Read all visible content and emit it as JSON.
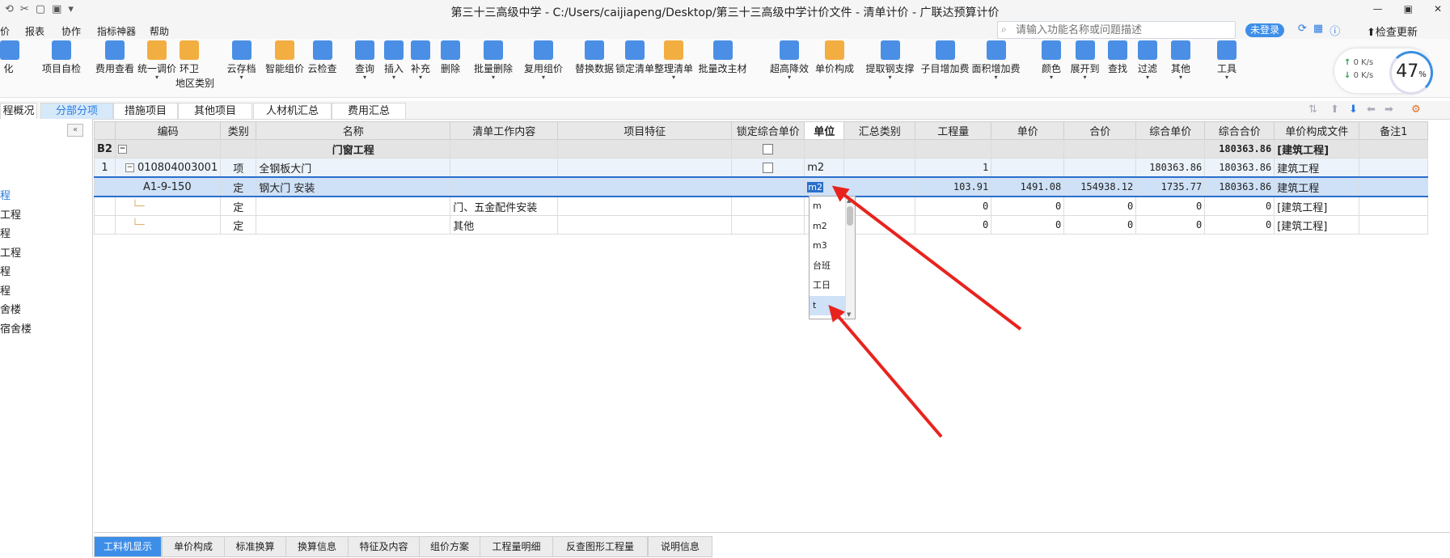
{
  "window": {
    "title": "第三十三高级中学 - C:/Users/caijiapeng/Desktop/第三十三高级中学计价文件 - 清单计价 - 广联达预算计价",
    "quick_access": [
      "⟲",
      "✂",
      "▢",
      "▣",
      "▾"
    ],
    "controls": [
      "—",
      "▣",
      "✕"
    ]
  },
  "menu": {
    "items": [
      "价",
      "报表",
      "协作",
      "指标神器",
      "帮助"
    ]
  },
  "search": {
    "placeholder": "请输入功能名称或问题描述"
  },
  "header_right": {
    "login_label": "未登录",
    "update_label": "检查更新",
    "tool_icons": [
      "⟳",
      "▦",
      "ⓘ"
    ]
  },
  "ribbon": {
    "buttons": [
      {
        "label": "化",
        "color": "#2a7be0",
        "icon": "partial-icon"
      },
      {
        "label": "项目自检",
        "color": "#2a7be0",
        "icon": "check-icon"
      },
      {
        "label": "费用查看",
        "color": "#2a7be0",
        "icon": "cost-view-icon"
      },
      {
        "label": "统一调价",
        "color": "#f0a020",
        "icon": "price-adjust-icon",
        "dropdown": true
      },
      {
        "label": "环卫",
        "sub": "地区类别",
        "color": "#f0a020",
        "icon": "region-icon"
      },
      {
        "label": "云存档",
        "color": "#2a7be0",
        "icon": "cloud-save-icon",
        "dropdown": true
      },
      {
        "label": "智能组价",
        "color": "#f0a020",
        "icon": "smart-price-icon"
      },
      {
        "label": "云检查",
        "color": "#2a7be0",
        "icon": "cloud-check-icon"
      },
      {
        "label": "查询",
        "color": "#2a7be0",
        "icon": "query-icon",
        "dropdown": true
      },
      {
        "label": "插入",
        "color": "#2a7be0",
        "icon": "insert-icon",
        "dropdown": true
      },
      {
        "label": "补充",
        "color": "#2a7be0",
        "icon": "supplement-icon",
        "dropdown": true
      },
      {
        "label": "删除",
        "color": "#2a7be0",
        "icon": "delete-icon"
      },
      {
        "label": "批量删除",
        "color": "#2a7be0",
        "icon": "batch-delete-icon",
        "dropdown": true
      },
      {
        "label": "复用组价",
        "color": "#2a7be0",
        "icon": "reuse-icon",
        "dropdown": true
      },
      {
        "label": "替换数据",
        "color": "#2a7be0",
        "icon": "replace-icon"
      },
      {
        "label": "锁定清单",
        "color": "#2a7be0",
        "icon": "lock-icon"
      },
      {
        "label": "整理清单",
        "color": "#f0a020",
        "icon": "organize-icon",
        "dropdown": true
      },
      {
        "label": "批量改主材",
        "color": "#2a7be0",
        "icon": "material-icon"
      },
      {
        "label": "超高降效",
        "color": "#2a7be0",
        "icon": "height-icon",
        "dropdown": true
      },
      {
        "label": "单价构成",
        "color": "#f0a020",
        "icon": "unit-price-icon"
      },
      {
        "label": "提取钢支撑",
        "color": "#2a7be0",
        "icon": "steel-icon",
        "dropdown": true
      },
      {
        "label": "子目增加费",
        "color": "#2a7be0",
        "icon": "sub-fee-icon"
      },
      {
        "label": "面积增加费",
        "color": "#2a7be0",
        "icon": "area-fee-icon",
        "dropdown": true
      },
      {
        "label": "颜色",
        "color": "#2a7be0",
        "icon": "color-icon",
        "dropdown": true
      },
      {
        "label": "展开到",
        "color": "#2a7be0",
        "icon": "expand-icon",
        "dropdown": true
      },
      {
        "label": "查找",
        "color": "#2a7be0",
        "icon": "find-icon"
      },
      {
        "label": "过滤",
        "color": "#2a7be0",
        "icon": "filter-icon",
        "dropdown": true
      },
      {
        "label": "其他",
        "color": "#2a7be0",
        "icon": "other-icon",
        "dropdown": true
      },
      {
        "label": "工具",
        "color": "#2a7be0",
        "icon": "tools-icon",
        "dropdown": true
      }
    ]
  },
  "network": {
    "up": "0  K/s",
    "down": "0  K/s",
    "gauge_value": "47",
    "gauge_unit": "%"
  },
  "tabs": [
    "程概况",
    "分部分项",
    "措施项目",
    "其他项目",
    "人材机汇总",
    "费用汇总"
  ],
  "active_tab": "分部分项",
  "left_tree": {
    "collapse_label": "«",
    "items": [
      "程",
      "工程",
      "程",
      "工程",
      "程",
      "程",
      "舍楼",
      "宿舍楼"
    ]
  },
  "grid": {
    "columns": [
      "",
      "编码",
      "类别",
      "名称",
      "清单工作内容",
      "项目特征",
      "锁定综合单价",
      "单位",
      "汇总类别",
      "工程量",
      "单价",
      "合价",
      "综合单价",
      "综合合价",
      "单价构成文件",
      "备注1"
    ],
    "rows": [
      {
        "idx": "B2",
        "code": "",
        "type": "",
        "name": "门窗工程",
        "work": "",
        "feature": "",
        "lock": true,
        "unit": "",
        "sum": "",
        "qty": "",
        "price": "",
        "total": "",
        "cprice": "",
        "ctotal": "180363.86",
        "file": "[建筑工程]",
        "note": ""
      },
      {
        "idx": "1",
        "code": "010804003001",
        "type": "项",
        "name": "全钢板大门",
        "work": "",
        "feature": "",
        "lock": true,
        "unit": "m2",
        "sum": "",
        "qty": "1",
        "price": "",
        "total": "",
        "cprice": "180363.86",
        "ctotal": "180363.86",
        "file": "建筑工程",
        "note": ""
      },
      {
        "idx": "",
        "code": "A1-9-150",
        "type": "定",
        "name": "钢大门 安装",
        "work": "",
        "feature": "",
        "lock": false,
        "unit": "m2",
        "sum": "",
        "qty": "103.91",
        "price": "1491.08",
        "total": "154938.12",
        "cprice": "1735.77",
        "ctotal": "180363.86",
        "file": "建筑工程",
        "note": ""
      },
      {
        "idx": "",
        "code": "",
        "type": "定",
        "name": "",
        "work": "门、五金配件安装",
        "feature": "",
        "lock": false,
        "unit": "",
        "sum": "",
        "qty": "0",
        "price": "0",
        "total": "0",
        "cprice": "0",
        "ctotal": "0",
        "file": "[建筑工程]",
        "note": ""
      },
      {
        "idx": "",
        "code": "",
        "type": "定",
        "name": "",
        "work": "其他",
        "feature": "",
        "lock": false,
        "unit": "",
        "sum": "",
        "qty": "0",
        "price": "0",
        "total": "0",
        "cprice": "0",
        "ctotal": "0",
        "file": "[建筑工程]",
        "note": ""
      }
    ]
  },
  "unit_dropdown": {
    "options": [
      "m",
      "m2",
      "m3",
      "台班",
      "工日",
      "t"
    ],
    "selected": "t"
  },
  "bottom_tabs": [
    "工料机显示",
    "单价构成",
    "标准换算",
    "换算信息",
    "特征及内容",
    "组价方案",
    "工程量明细",
    "反查图形工程量",
    "说明信息"
  ],
  "active_bottom_tab": "工料机显示",
  "annotation_color": "#e8231e"
}
